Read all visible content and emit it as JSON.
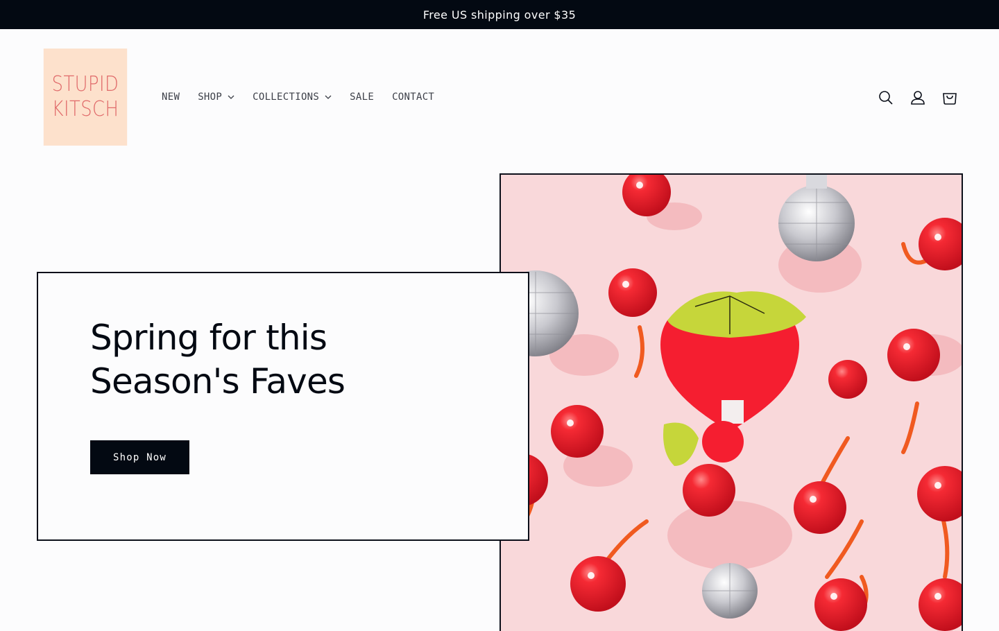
{
  "announcement": {
    "text": "Free US shipping over $35"
  },
  "logo": {
    "line1": "STUPID",
    "line2": "KITSCH"
  },
  "nav": {
    "items": [
      {
        "label": "NEW",
        "has_dropdown": false
      },
      {
        "label": "SHOP",
        "has_dropdown": true
      },
      {
        "label": "COLLECTIONS",
        "has_dropdown": true
      },
      {
        "label": "SALE",
        "has_dropdown": false
      },
      {
        "label": "CONTACT",
        "has_dropdown": false
      }
    ]
  },
  "header_icons": [
    "search-icon",
    "account-icon",
    "cart-icon"
  ],
  "hero": {
    "title_line1": "Spring for this",
    "title_line2": "Season's Faves",
    "button_label": "Shop Now"
  },
  "colors": {
    "announcement_bg": "#030912",
    "logo_bg": "#fde1cc",
    "logo_text": "#e06a6a",
    "hero_image_bg": "#f9d8da",
    "cherry_red": "#f01e2c",
    "leaf_green": "#c6d63a"
  }
}
